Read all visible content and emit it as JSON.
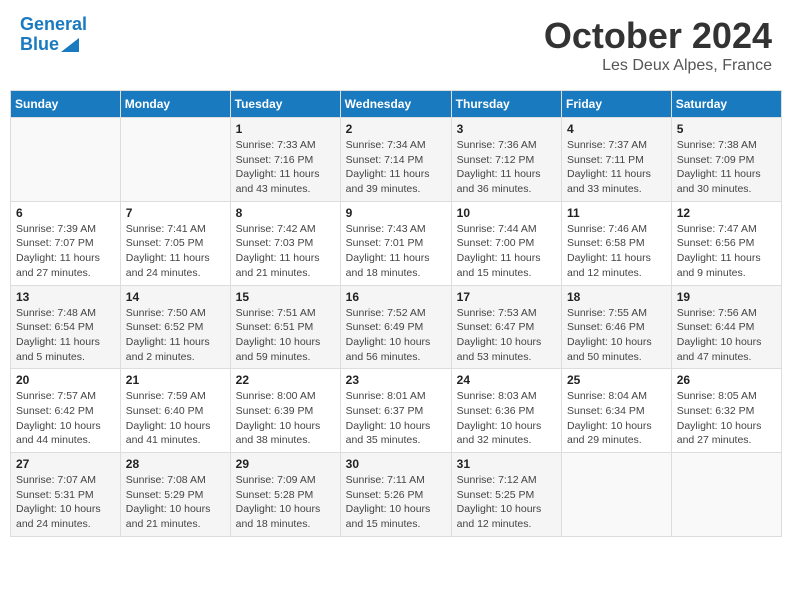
{
  "header": {
    "logo_line1": "General",
    "logo_line2": "Blue",
    "month": "October 2024",
    "location": "Les Deux Alpes, France"
  },
  "weekdays": [
    "Sunday",
    "Monday",
    "Tuesday",
    "Wednesday",
    "Thursday",
    "Friday",
    "Saturday"
  ],
  "weeks": [
    [
      {
        "day": "",
        "info": ""
      },
      {
        "day": "",
        "info": ""
      },
      {
        "day": "1",
        "info": "Sunrise: 7:33 AM\nSunset: 7:16 PM\nDaylight: 11 hours and 43 minutes."
      },
      {
        "day": "2",
        "info": "Sunrise: 7:34 AM\nSunset: 7:14 PM\nDaylight: 11 hours and 39 minutes."
      },
      {
        "day": "3",
        "info": "Sunrise: 7:36 AM\nSunset: 7:12 PM\nDaylight: 11 hours and 36 minutes."
      },
      {
        "day": "4",
        "info": "Sunrise: 7:37 AM\nSunset: 7:11 PM\nDaylight: 11 hours and 33 minutes."
      },
      {
        "day": "5",
        "info": "Sunrise: 7:38 AM\nSunset: 7:09 PM\nDaylight: 11 hours and 30 minutes."
      }
    ],
    [
      {
        "day": "6",
        "info": "Sunrise: 7:39 AM\nSunset: 7:07 PM\nDaylight: 11 hours and 27 minutes."
      },
      {
        "day": "7",
        "info": "Sunrise: 7:41 AM\nSunset: 7:05 PM\nDaylight: 11 hours and 24 minutes."
      },
      {
        "day": "8",
        "info": "Sunrise: 7:42 AM\nSunset: 7:03 PM\nDaylight: 11 hours and 21 minutes."
      },
      {
        "day": "9",
        "info": "Sunrise: 7:43 AM\nSunset: 7:01 PM\nDaylight: 11 hours and 18 minutes."
      },
      {
        "day": "10",
        "info": "Sunrise: 7:44 AM\nSunset: 7:00 PM\nDaylight: 11 hours and 15 minutes."
      },
      {
        "day": "11",
        "info": "Sunrise: 7:46 AM\nSunset: 6:58 PM\nDaylight: 11 hours and 12 minutes."
      },
      {
        "day": "12",
        "info": "Sunrise: 7:47 AM\nSunset: 6:56 PM\nDaylight: 11 hours and 9 minutes."
      }
    ],
    [
      {
        "day": "13",
        "info": "Sunrise: 7:48 AM\nSunset: 6:54 PM\nDaylight: 11 hours and 5 minutes."
      },
      {
        "day": "14",
        "info": "Sunrise: 7:50 AM\nSunset: 6:52 PM\nDaylight: 11 hours and 2 minutes."
      },
      {
        "day": "15",
        "info": "Sunrise: 7:51 AM\nSunset: 6:51 PM\nDaylight: 10 hours and 59 minutes."
      },
      {
        "day": "16",
        "info": "Sunrise: 7:52 AM\nSunset: 6:49 PM\nDaylight: 10 hours and 56 minutes."
      },
      {
        "day": "17",
        "info": "Sunrise: 7:53 AM\nSunset: 6:47 PM\nDaylight: 10 hours and 53 minutes."
      },
      {
        "day": "18",
        "info": "Sunrise: 7:55 AM\nSunset: 6:46 PM\nDaylight: 10 hours and 50 minutes."
      },
      {
        "day": "19",
        "info": "Sunrise: 7:56 AM\nSunset: 6:44 PM\nDaylight: 10 hours and 47 minutes."
      }
    ],
    [
      {
        "day": "20",
        "info": "Sunrise: 7:57 AM\nSunset: 6:42 PM\nDaylight: 10 hours and 44 minutes."
      },
      {
        "day": "21",
        "info": "Sunrise: 7:59 AM\nSunset: 6:40 PM\nDaylight: 10 hours and 41 minutes."
      },
      {
        "day": "22",
        "info": "Sunrise: 8:00 AM\nSunset: 6:39 PM\nDaylight: 10 hours and 38 minutes."
      },
      {
        "day": "23",
        "info": "Sunrise: 8:01 AM\nSunset: 6:37 PM\nDaylight: 10 hours and 35 minutes."
      },
      {
        "day": "24",
        "info": "Sunrise: 8:03 AM\nSunset: 6:36 PM\nDaylight: 10 hours and 32 minutes."
      },
      {
        "day": "25",
        "info": "Sunrise: 8:04 AM\nSunset: 6:34 PM\nDaylight: 10 hours and 29 minutes."
      },
      {
        "day": "26",
        "info": "Sunrise: 8:05 AM\nSunset: 6:32 PM\nDaylight: 10 hours and 27 minutes."
      }
    ],
    [
      {
        "day": "27",
        "info": "Sunrise: 7:07 AM\nSunset: 5:31 PM\nDaylight: 10 hours and 24 minutes."
      },
      {
        "day": "28",
        "info": "Sunrise: 7:08 AM\nSunset: 5:29 PM\nDaylight: 10 hours and 21 minutes."
      },
      {
        "day": "29",
        "info": "Sunrise: 7:09 AM\nSunset: 5:28 PM\nDaylight: 10 hours and 18 minutes."
      },
      {
        "day": "30",
        "info": "Sunrise: 7:11 AM\nSunset: 5:26 PM\nDaylight: 10 hours and 15 minutes."
      },
      {
        "day": "31",
        "info": "Sunrise: 7:12 AM\nSunset: 5:25 PM\nDaylight: 10 hours and 12 minutes."
      },
      {
        "day": "",
        "info": ""
      },
      {
        "day": "",
        "info": ""
      }
    ]
  ]
}
